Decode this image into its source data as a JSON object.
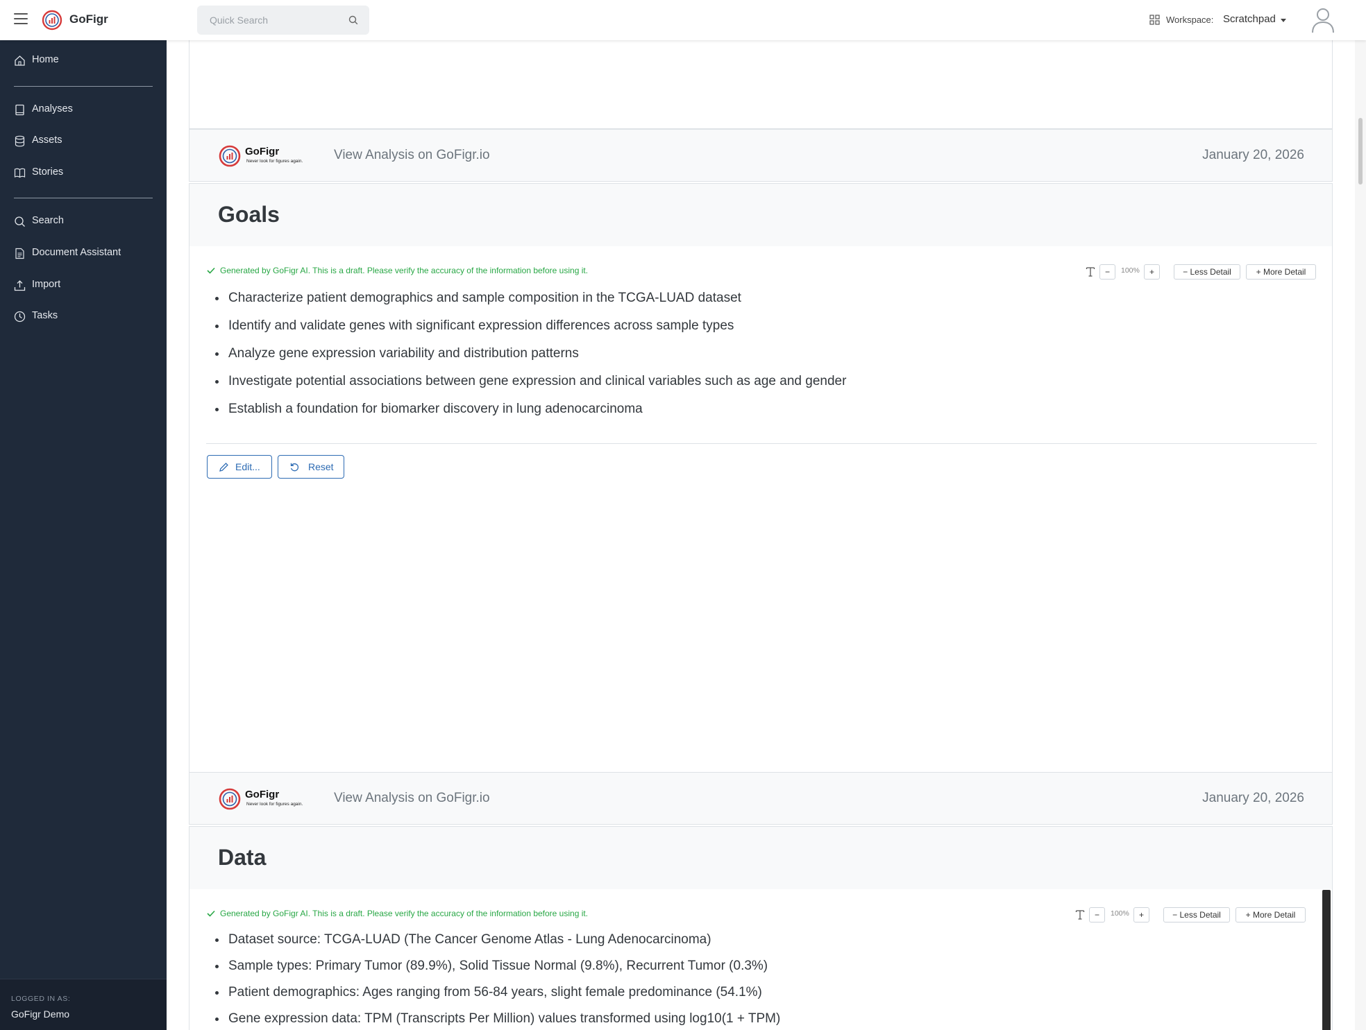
{
  "app": {
    "name": "GoFigr"
  },
  "search": {
    "placeholder": "Quick Search"
  },
  "workspace": {
    "label": "Workspace:",
    "value": "Scratchpad"
  },
  "sidebar": {
    "items": [
      {
        "label": "Home",
        "icon": "home-icon"
      },
      {
        "label": "Analyses",
        "icon": "book-icon"
      },
      {
        "label": "Assets",
        "icon": "database-icon"
      },
      {
        "label": "Stories",
        "icon": "open-book-icon"
      },
      {
        "label": "Search",
        "icon": "search-icon"
      },
      {
        "label": "Document Assistant",
        "icon": "document-icon"
      },
      {
        "label": "Import",
        "icon": "upload-icon"
      },
      {
        "label": "Tasks",
        "icon": "clock-icon"
      }
    ],
    "footer": {
      "label": "LOGGED IN AS:",
      "user": "GoFigr Demo"
    }
  },
  "footers": [
    {
      "brand": "GoFigr",
      "tagline": "Never look for figures again.",
      "link": "View Analysis on GoFigr.io",
      "date": "January 20, 2026"
    },
    {
      "brand": "GoFigr",
      "tagline": "Never look for figures again.",
      "link": "View Analysis on GoFigr.io",
      "date": "January 20, 2026"
    }
  ],
  "sections": [
    {
      "title": "Goals",
      "ai_note": "Generated by GoFigr AI. This is a draft. Please verify the accuracy of the information before using it.",
      "zoom": "100%",
      "less_detail": "Less Detail",
      "more_detail": "More Detail",
      "bullets": [
        "Characterize patient demographics and sample composition in the TCGA-LUAD dataset",
        "Identify and validate genes with significant expression differences across sample types",
        "Analyze gene expression variability and distribution patterns",
        "Investigate potential associations between gene expression and clinical variables such as age and gender",
        "Establish a foundation for biomarker discovery in lung adenocarcinoma"
      ],
      "edit_label": "Edit...",
      "reset_label": "Reset"
    },
    {
      "title": "Data",
      "ai_note": "Generated by GoFigr AI. This is a draft. Please verify the accuracy of the information before using it.",
      "zoom": "100%",
      "less_detail": "Less Detail",
      "more_detail": "More Detail",
      "bullets": [
        "Dataset source: TCGA-LUAD (The Cancer Genome Atlas - Lung Adenocarcinoma)",
        "Sample types: Primary Tumor (89.9%), Solid Tissue Normal (9.8%), Recurrent Tumor (0.3%)",
        "Patient demographics: Ages ranging from 56-84 years, slight female predominance (54.1%)",
        "Gene expression data: TPM (Transcripts Per Million) values transformed using log10(1 + TPM)"
      ]
    }
  ],
  "colors": {
    "sidebar": "#1f2a3a",
    "accent": "#2d6bb3",
    "ai_note": "#28a745"
  }
}
